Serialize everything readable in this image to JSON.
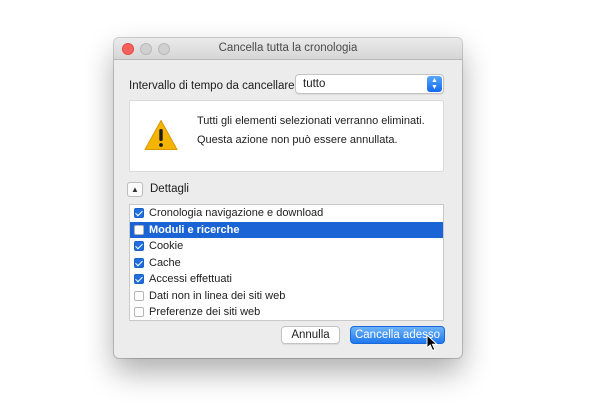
{
  "window": {
    "title": "Cancella tutta la cronologia"
  },
  "interval": {
    "label": "Intervallo di tempo da cancellare:",
    "selected": "tutto"
  },
  "warning": {
    "icon": "warning-icon",
    "line1": "Tutti gli elementi selezionati verranno eliminati.",
    "line2": "Questa azione non può essere annullata."
  },
  "details": {
    "label": "Dettagli",
    "expanded": true
  },
  "items": [
    {
      "label": "Cronologia navigazione e download",
      "checked": true,
      "selected": false
    },
    {
      "label": "Moduli e ricerche",
      "checked": false,
      "selected": true
    },
    {
      "label": "Cookie",
      "checked": true,
      "selected": false
    },
    {
      "label": "Cache",
      "checked": true,
      "selected": false
    },
    {
      "label": "Accessi effettuati",
      "checked": true,
      "selected": false
    },
    {
      "label": "Dati non in linea dei siti web",
      "checked": false,
      "selected": false
    },
    {
      "label": "Preferenze dei siti web",
      "checked": false,
      "selected": false
    }
  ],
  "buttons": {
    "cancel": "Annulla",
    "confirm": "Cancella adesso"
  },
  "colors": {
    "accent": "#1a64d6",
    "close": "#fc605c",
    "warning": "#f5b400"
  }
}
